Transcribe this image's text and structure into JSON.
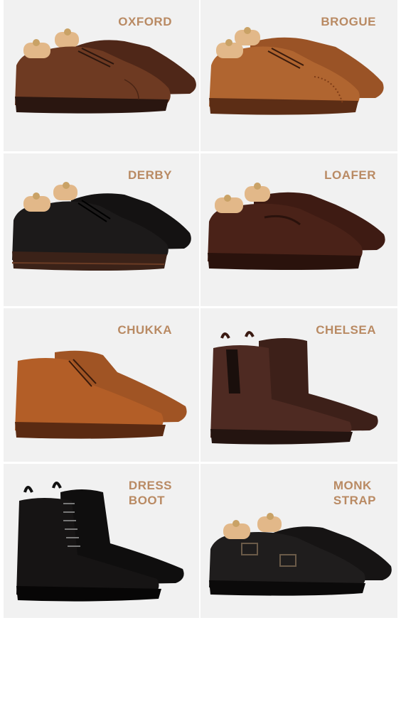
{
  "styles": [
    {
      "label": "OXFORD"
    },
    {
      "label": "BROGUE"
    },
    {
      "label": "DERBY"
    },
    {
      "label": "LOAFER"
    },
    {
      "label": "CHUKKA"
    },
    {
      "label": "CHELSEA"
    },
    {
      "label_lines": [
        "DRESS",
        "BOOT"
      ]
    },
    {
      "label_lines": [
        "MONK",
        "STRAP"
      ]
    }
  ],
  "colors": {
    "label": "#b98a63",
    "panel": "#f1f1f1",
    "oxford_leather": "#6e3a22",
    "brogue_leather": "#b06530",
    "derby_leather": "#1c1a1a",
    "loafer_leather": "#4a2218",
    "chukka_leather": "#b35e27",
    "chelsea_leather": "#4e2a22",
    "dressboot_leather": "#161414",
    "monk_leather": "#1f1d1d",
    "shoe_tree": "#e2b889"
  },
  "icons": [
    "oxford-shoe-image",
    "brogue-shoe-image",
    "derby-shoe-image",
    "loafer-shoe-image",
    "chukka-boot-image",
    "chelsea-boot-image",
    "dress-boot-image",
    "monk-strap-shoe-image"
  ]
}
